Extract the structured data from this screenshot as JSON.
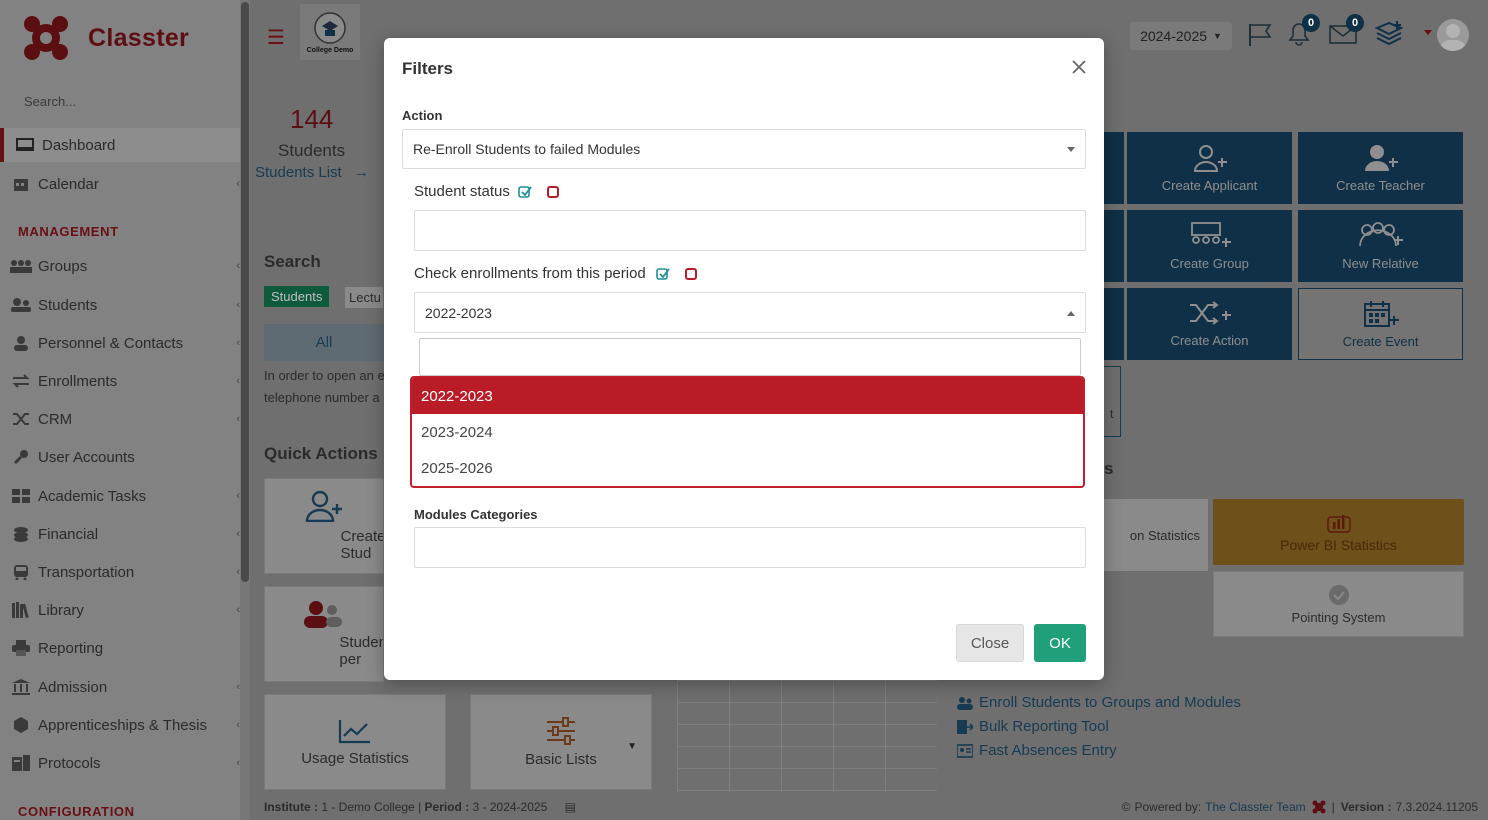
{
  "sidebar": {
    "brand": "Classter",
    "search_placeholder": "Search...",
    "items": [
      {
        "label": "Dashboard"
      },
      {
        "label": "Calendar"
      },
      {
        "label": "Groups"
      },
      {
        "label": "Students"
      },
      {
        "label": "Personnel & Contacts"
      },
      {
        "label": "Enrollments"
      },
      {
        "label": "CRM"
      },
      {
        "label": "User Accounts"
      },
      {
        "label": "Academic Tasks"
      },
      {
        "label": "Financial"
      },
      {
        "label": "Transportation"
      },
      {
        "label": "Library"
      },
      {
        "label": "Reporting"
      },
      {
        "label": "Admission"
      },
      {
        "label": "Apprenticeships & Thesis"
      },
      {
        "label": "Protocols"
      }
    ],
    "section_management": "MANAGEMENT",
    "section_configuration": "CONFIGURATION"
  },
  "header": {
    "college_logo_text": "College Demo",
    "year": "2024-2025",
    "notifications_count": "0",
    "messages_count": "0"
  },
  "main": {
    "stat_number": "144",
    "stat_label": "Students",
    "stat_link": "Students List",
    "search_heading": "Search",
    "tab_students": "Students",
    "tab_lectures": "Lectu",
    "all_button": "All",
    "help_line1": "In order to open an e",
    "help_line2": "telephone number a",
    "quick_actions_heading": "Quick Actions",
    "qa_create_student": "Create Stud",
    "qa_students_per": "Students per",
    "qa_usage_statistics": "Usage Statistics",
    "qa_basic_lists": "Basic Lists",
    "tiles": {
      "create_applicant": "Create Applicant",
      "create_teacher": "Create Teacher",
      "create_group": "Create Group",
      "new_relative": "New Relative",
      "create_action": "Create Action",
      "create_event": "Create Event"
    },
    "stats_partial_heading": "s",
    "stats_partial_label": "on Statistics",
    "power_bi": "Power BI Statistics",
    "pointing_system": "Pointing System",
    "links": {
      "enroll": "Enroll Students to Groups and Modules",
      "bulk": "Bulk Reporting Tool",
      "fast": "Fast Absences Entry"
    }
  },
  "footer": {
    "institute_label": "Institute :",
    "institute_value": "1 - Demo College",
    "period_label": "Period :",
    "period_value": "3 - 2024-2025",
    "powered_by": "Powered by:",
    "team": "The Classter Team",
    "version_label": "Version :",
    "version_value": "7.3.2024.11205"
  },
  "modal": {
    "title": "Filters",
    "action_label": "Action",
    "action_value": "Re-Enroll Students to failed Modules",
    "student_status_label": "Student status",
    "check_enrollments_label": "Check enrollments from this period",
    "period_value": "2022-2023",
    "dropdown_options": [
      "2022-2023",
      "2023-2024",
      "2025-2026"
    ],
    "modules_categories_label": "Modules Categories",
    "close_button": "Close",
    "ok_button": "OK"
  },
  "colors": {
    "brand_red": "#b91c26",
    "ok_green": "#1fa07a",
    "tile_blue": "#0f3046",
    "power_bi_orange": "#e8a13a"
  }
}
